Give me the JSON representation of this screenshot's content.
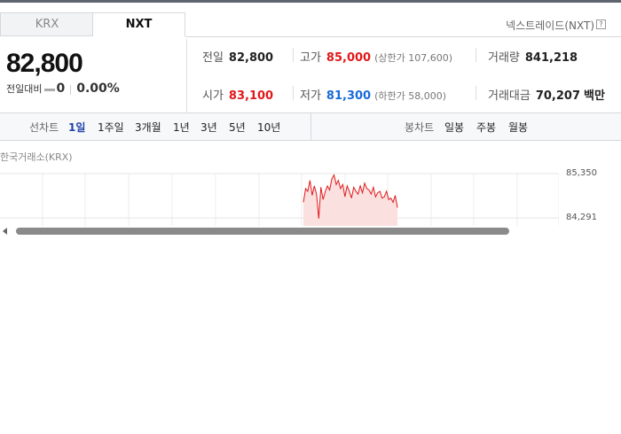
{
  "tabs": [
    {
      "label": "KRX"
    },
    {
      "label": "NXT"
    }
  ],
  "exchange_label": "넥스트레이드(NXT)",
  "help_glyph": "?",
  "price": "82,800",
  "change": {
    "label": "전일대비",
    "value": "0",
    "rate": "0.00%"
  },
  "stats": {
    "prev_close": {
      "label": "전일",
      "value": "82,800"
    },
    "high": {
      "label": "고가",
      "value": "85,000",
      "limit": "(상한가 107,600)"
    },
    "volume": {
      "label": "거래량",
      "value": "841,218"
    },
    "open": {
      "label": "시가",
      "value": "83,100"
    },
    "low": {
      "label": "저가",
      "value": "81,300",
      "limit": "(하한가 58,000)"
    },
    "amount": {
      "label": "거래대금",
      "value": "70,207",
      "unit": "백만"
    }
  },
  "line_chart": {
    "label": "선차트",
    "periods": [
      "1일",
      "1주일",
      "3개월",
      "1년",
      "3년",
      "5년",
      "10년"
    ],
    "selected": "1일"
  },
  "candle_chart": {
    "label": "봉차트",
    "periods": [
      "일봉",
      "주봉",
      "월봉"
    ]
  },
  "chart_source": "한국거래소(KRX)",
  "colors": {
    "up": "#e0191b",
    "down": "#1a6ad6",
    "selected": "#2244aa"
  },
  "chart_data": {
    "type": "area",
    "y_ticks": [
      "85,350",
      "84,291"
    ],
    "ylim": [
      83500,
      85350
    ],
    "series": [
      {
        "values": [
          84300,
          84800,
          84700,
          85100,
          84550,
          84900,
          84600,
          83700,
          84850,
          84400,
          84700,
          84900,
          84750,
          85150,
          85300,
          84950,
          85100,
          84800,
          84950,
          84500,
          84900,
          84700,
          84450,
          84850,
          84700,
          84600,
          84900,
          84650,
          85000,
          84800,
          84750,
          84600,
          84850,
          84500,
          84650,
          84700,
          84450,
          84500,
          84700,
          84400,
          84450,
          84300,
          84550,
          84100
        ]
      }
    ]
  }
}
